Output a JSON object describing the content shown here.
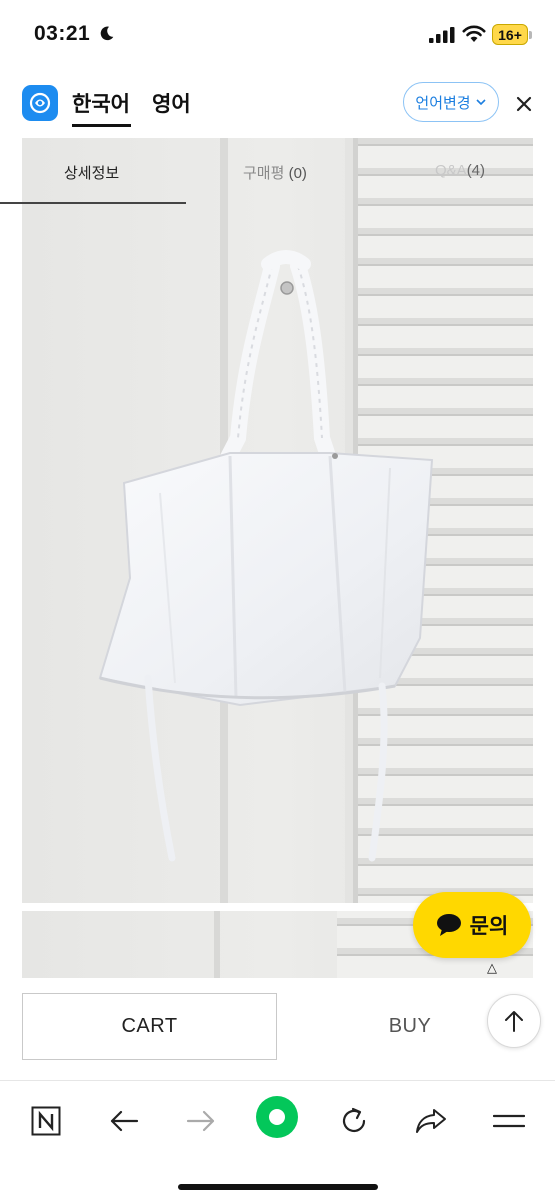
{
  "status_bar": {
    "time": "03:21",
    "moon_icon": "moon-icon",
    "signal_icon": "cellular-signal-icon",
    "wifi_icon": "wifi-icon",
    "battery": "16+"
  },
  "translate_bar": {
    "logo_icon": "translate-app-logo-icon",
    "lang_korean": "한국어",
    "lang_english": "영어",
    "change_language": "언어변경",
    "close_icon": "close-icon"
  },
  "detail_tabs": {
    "detail_info": "상세정보",
    "reviews": "구매평",
    "reviews_count": "(0)",
    "qa": "Q&A",
    "qa_count": "(4)"
  },
  "inquiry": {
    "label": "문의",
    "icon": "chat-bubble-icon"
  },
  "actions": {
    "cart": "CART",
    "buy": "BUY",
    "scroll_top_icon": "arrow-up-icon"
  },
  "browser_nav": {
    "items": [
      "naver-n-icon",
      "back-arrow-icon",
      "forward-arrow-icon",
      "green-home-icon",
      "refresh-icon",
      "share-icon",
      "menu-icon"
    ]
  },
  "colors": {
    "accent_blue": "#1d8cf0",
    "inquiry_yellow": "#ffd800",
    "naver_green": "#03c75a"
  }
}
